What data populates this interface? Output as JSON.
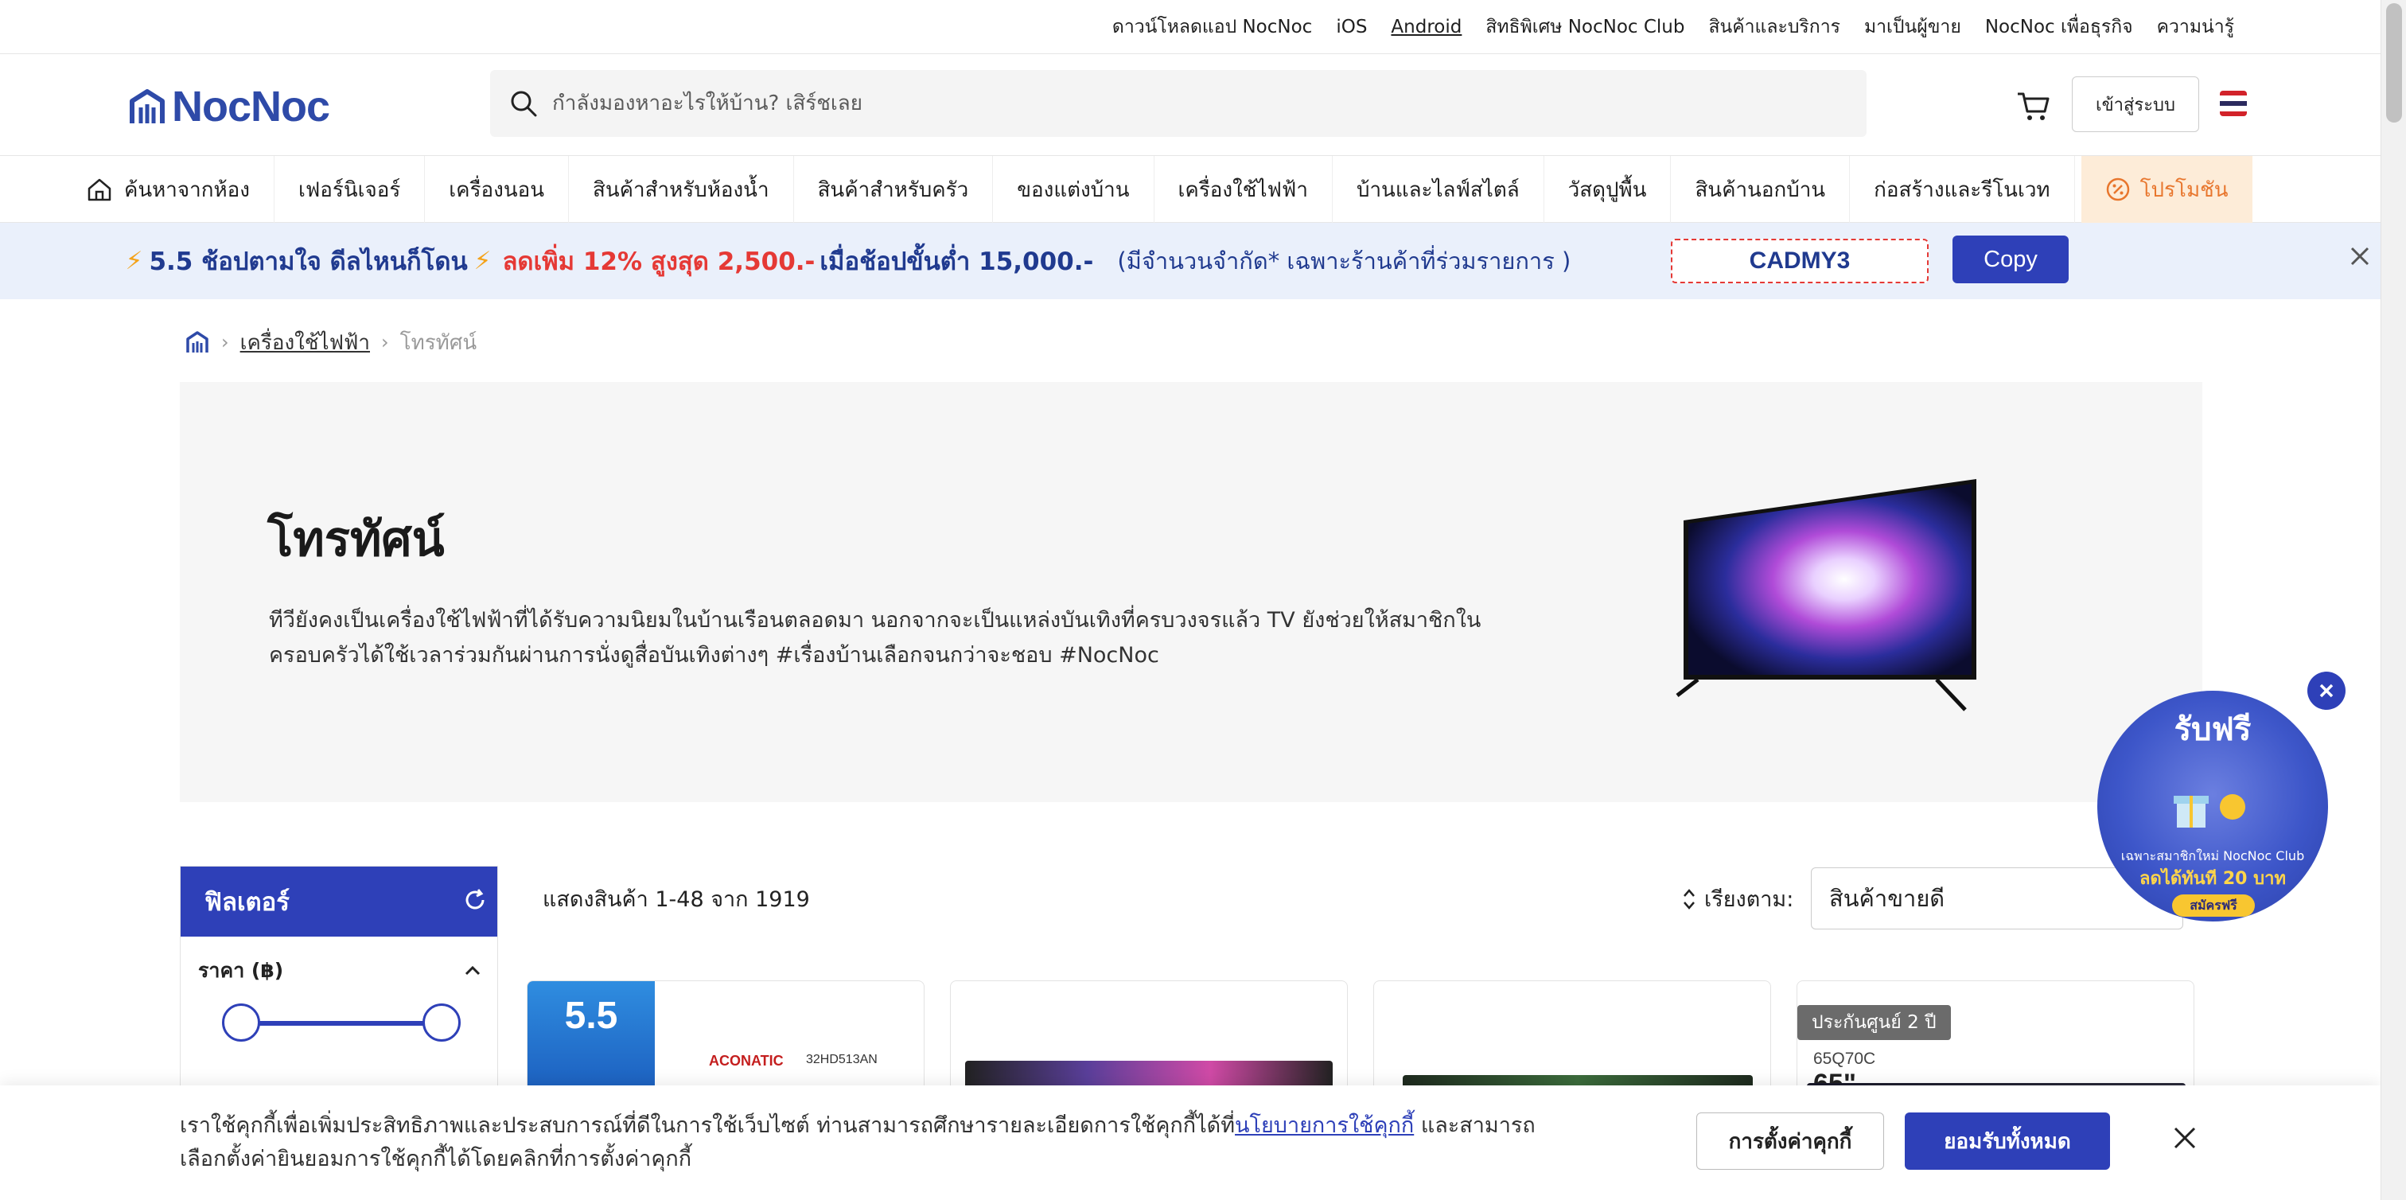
{
  "topbar": {
    "items": [
      {
        "label": "ดาวน์โหลดแอป NocNoc"
      },
      {
        "label": "iOS"
      },
      {
        "label": "Android"
      },
      {
        "label": "สิทธิพิเศษ NocNoc Club"
      },
      {
        "label": "สินค้าและบริการ"
      },
      {
        "label": "มาเป็นผู้ขาย"
      },
      {
        "label": "NocNoc เพื่อธุรกิจ"
      },
      {
        "label": "ความน่ารู้"
      }
    ]
  },
  "header": {
    "logo_text": "NocNoc",
    "search_placeholder": "กำลังมองหาอะไรให้บ้าน? เสิร์ชเลย",
    "login_label": "เข้าสู่ระบบ",
    "brand_color": "#2e40b8"
  },
  "categories": [
    {
      "label": "ค้นหาจากห้อง"
    },
    {
      "label": "เฟอร์นิเจอร์"
    },
    {
      "label": "เครื่องนอน"
    },
    {
      "label": "สินค้าสำหรับห้องน้ำ"
    },
    {
      "label": "สินค้าสำหรับครัว"
    },
    {
      "label": "ของแต่งบ้าน"
    },
    {
      "label": "เครื่องใช้ไฟฟ้า"
    },
    {
      "label": "บ้านและไลฟ์สไตล์"
    },
    {
      "label": "วัสดุปูพื้น"
    },
    {
      "label": "สินค้านอกบ้าน"
    },
    {
      "label": "ก่อสร้างและรีโนเวท"
    },
    {
      "label": "โปรโมชัน"
    }
  ],
  "banner": {
    "part1": "5.5 ช้อปตามใจ ดีลไหนก็โดน",
    "part2": "ลดเพิ่ม 12% สูงสุด 2,500.-",
    "part3": "เมื่อช้อปขั้นต่ำ 15,000.-",
    "note": "(มีจำนวนจำกัด* เฉพาะร้านค้าที่ร่วมรายการ )",
    "coupon_code": "CADMY3",
    "copy_label": "Copy"
  },
  "breadcrumb": {
    "link": "เครื่องใช้ไฟฟ้า",
    "current": "โทรทัศน์"
  },
  "hero": {
    "title": "โทรทัศน์",
    "description": "ทีวียังคงเป็นเครื่องใช้ไฟฟ้าที่ได้รับความนิยมในบ้านเรือนตลอดมา นอกจากจะเป็นแหล่งบันเทิงที่ครบวงจรแล้ว TV ยังช่วยให้สมาชิกในครอบครัวได้ใช้เวลาร่วมกันผ่านการนั่งดูสื่อบันเทิงต่างๆ #เรื่องบ้านเลือกจนกว่าจะชอบ #NocNoc"
  },
  "filter": {
    "title": "ฟิลเตอร์",
    "price_label": "ราคา (฿)"
  },
  "listing": {
    "result_text": "แสดงสินค้า 1-48 จาก 1919",
    "sort_label": "เรียงตาม:",
    "sort_value": "สินค้าขายดี"
  },
  "products": [
    {
      "promo": "5.5",
      "brand": "ACONATIC",
      "model": "32HD513AN"
    },
    {},
    {},
    {
      "warranty": "ประกันศูนย์ 2 ปี",
      "model": "65Q70C",
      "size": "65\""
    }
  ],
  "reward": {
    "title": "รับฟรี",
    "line1": "เฉพาะสมาชิกใหม่ NocNoc Club",
    "line2": "ลดได้ทันที 20 บาท",
    "cta": "สมัครฟรี"
  },
  "cookie": {
    "text_before": "เราใช้คุกกี้เพื่อเพิ่มประสิทธิภาพและประสบการณ์ที่ดีในการใช้เว็บไซต์ ท่านสามารถศึกษารายละเอียดการใช้คุกกี้ได้ที่",
    "link_label": "นโยบายการใช้คุกกี้",
    "text_after": "และสามารถเลือกตั้งค่ายินยอมการใช้คุกกี้ได้โดยคลิกที่การตั้งค่าคุกกี้",
    "settings_label": "การตั้งค่าคุกกี้",
    "accept_label": "ยอมรับทั้งหมด"
  }
}
